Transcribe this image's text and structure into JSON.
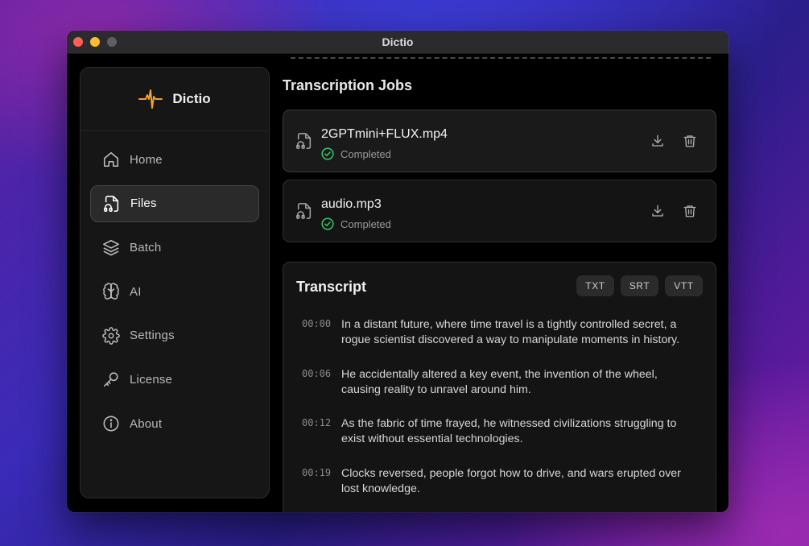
{
  "window": {
    "title": "Dictio"
  },
  "sidebar": {
    "brand": {
      "name": "Dictio",
      "icon": "waveform-pulse-icon",
      "accent": "#f0a030"
    },
    "items": [
      {
        "label": "Home",
        "icon": "home-icon",
        "active": false
      },
      {
        "label": "Files",
        "icon": "audio-file-icon",
        "active": true
      },
      {
        "label": "Batch",
        "icon": "layers-icon",
        "active": false
      },
      {
        "label": "AI",
        "icon": "brain-icon",
        "active": false
      },
      {
        "label": "Settings",
        "icon": "gear-icon",
        "active": false
      },
      {
        "label": "License",
        "icon": "key-icon",
        "active": false
      },
      {
        "label": "About",
        "icon": "info-icon",
        "active": false
      }
    ]
  },
  "main": {
    "section_title": "Transcription Jobs",
    "jobs": [
      {
        "name": "2GPTmini+FLUX.mp4",
        "status": "Completed"
      },
      {
        "name": "audio.mp3",
        "status": "Completed"
      }
    ],
    "transcript": {
      "title": "Transcript",
      "formats": [
        "TXT",
        "SRT",
        "VTT"
      ],
      "segments": [
        {
          "time": "00:00",
          "text": "In a distant future, where time travel is a tightly controlled secret, a rogue scientist discovered a way to manipulate moments in history."
        },
        {
          "time": "00:06",
          "text": "He accidentally altered a key event, the invention of the wheel, causing reality to unravel around him."
        },
        {
          "time": "00:12",
          "text": "As the fabric of time frayed, he witnessed civilizations struggling to exist without essential technologies."
        },
        {
          "time": "00:19",
          "text": "Clocks reversed, people forgot how to drive, and wars erupted over lost knowledge."
        }
      ]
    }
  },
  "colors": {
    "status_ok": "#3cc46a",
    "accent": "#f0a030"
  }
}
